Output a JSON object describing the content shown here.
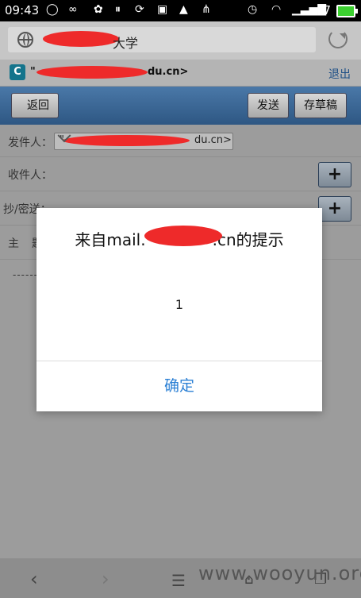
{
  "status_bar": {
    "time": "09:43",
    "battery_level": "47",
    "icons": [
      "chat-icon",
      "infinity-icon",
      "paw-icon",
      "pause-circle-icon",
      "sync-icon",
      "image-icon",
      "warning-icon",
      "usb-icon",
      "alarm-icon",
      "wifi-icon",
      "signal-icon",
      "battery-icon"
    ]
  },
  "url_bar": {
    "title_suffix": "大学"
  },
  "account_bar": {
    "email_start": "\"",
    "email_domain_end": "du.cn>",
    "logout_label": "退出"
  },
  "toolbar": {
    "back_label": "返回",
    "send_label": "发送",
    "draft_label": "存草稿"
  },
  "form": {
    "sender_label": "发件人：",
    "sender_value_start": "\"",
    "sender_value_end": "du.cn>",
    "recipient_label": "收件人：",
    "cc_label": "抄/密送：",
    "subject_label": "主",
    "subject_label_tail": "题",
    "add_button_symbol": "+",
    "body_separator": "------"
  },
  "dialog": {
    "title_prefix": "来自mail.",
    "title_suffix": ".cn的提示",
    "message": "1",
    "confirm_label": "确定"
  },
  "nav": {
    "back": "‹",
    "forward": "›",
    "menu": "☰"
  },
  "watermark": "www.wooyun.org",
  "colors": {
    "toolbar": "#3a6694",
    "dialog_button": "#2a7fd4",
    "redaction": "#ee2a2a"
  }
}
